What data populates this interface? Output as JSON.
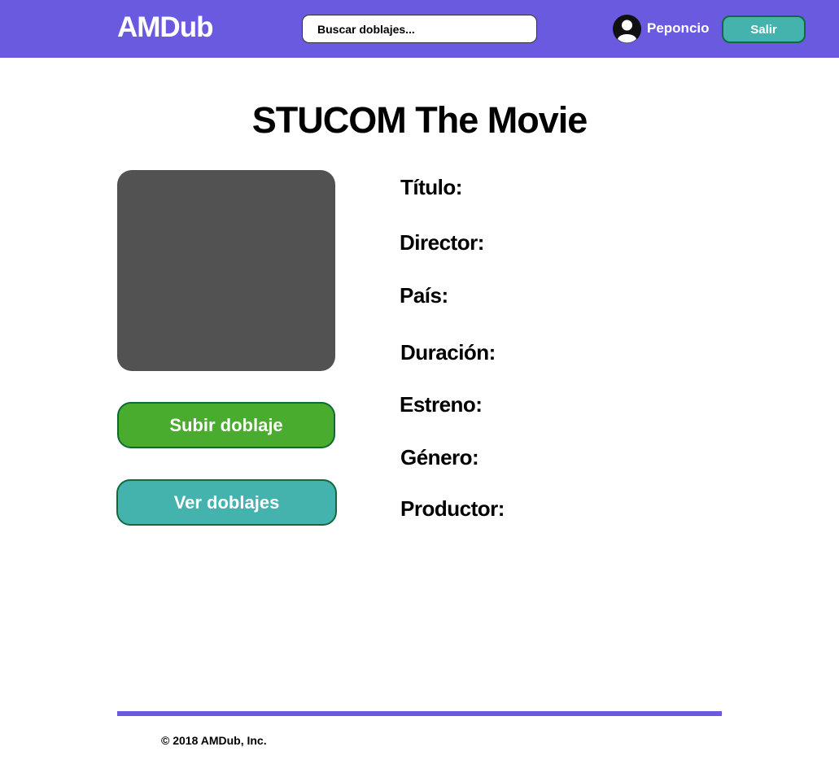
{
  "header": {
    "logo": "AMDub",
    "search_placeholder": "Buscar doblajes...",
    "username": "Peponcio",
    "logout_label": "Salir",
    "avatar_icon": "user-circle-icon"
  },
  "movie": {
    "title": "STUCOM The Movie",
    "fields": {
      "titulo": "Título:",
      "director": "Director:",
      "pais": "País:",
      "duracion": "Duración:",
      "estreno": "Estreno:",
      "genero": "Género:",
      "productor": "Productor:"
    }
  },
  "actions": {
    "upload_label": "Subir doblaje",
    "view_label": "Ver doblajes"
  },
  "footer": {
    "copyright": "© 2018 AMDub, Inc."
  },
  "colors": {
    "brand": "#6a5ae0",
    "teal": "#44b3ae",
    "green": "#4aac2e",
    "poster": "#525252"
  }
}
